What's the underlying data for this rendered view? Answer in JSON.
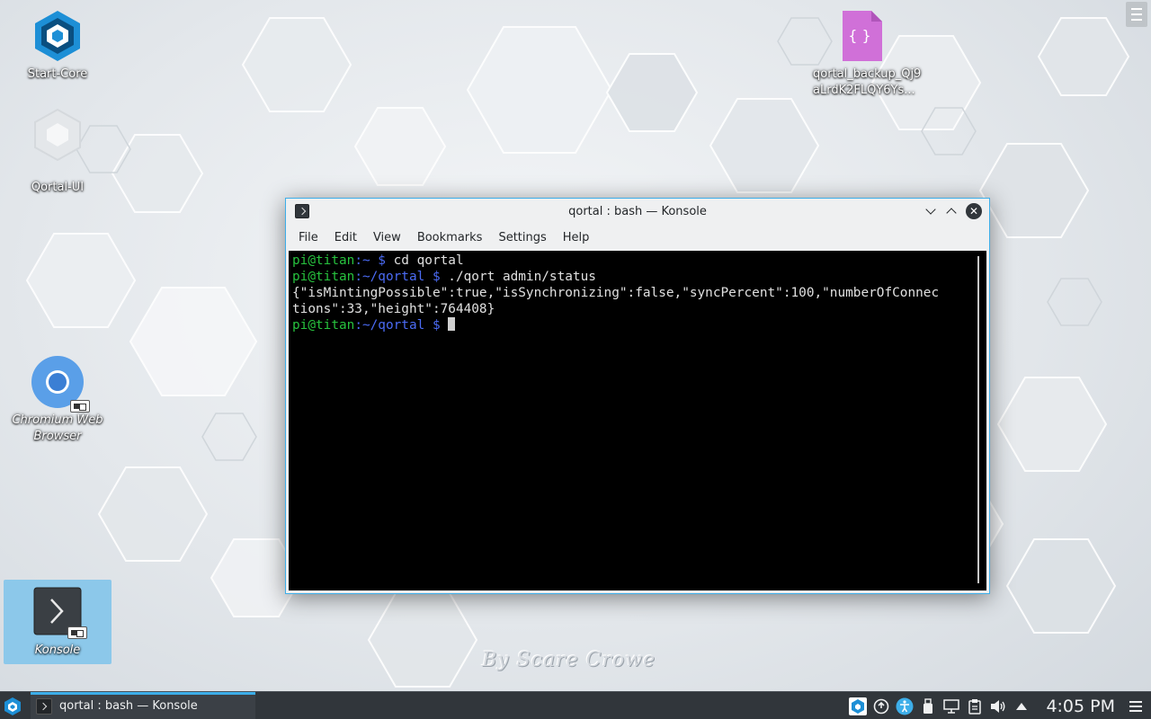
{
  "desktop": {
    "icons": [
      {
        "label": "Start-Core"
      },
      {
        "label": "Qortal-UI"
      },
      {
        "label_line1": "qortal_backup_Qj9",
        "label_line2": "aLrdK2FLQY6Ys..."
      },
      {
        "label_line1": "Chromium Web",
        "label_line2": "Browser"
      },
      {
        "label": "Konsole"
      }
    ],
    "file_icon_glyph": "{ }",
    "watermark": "By Scare Crowe"
  },
  "window": {
    "title": "qortal : bash — Konsole",
    "menu": [
      "File",
      "Edit",
      "View",
      "Bookmarks",
      "Settings",
      "Help"
    ]
  },
  "terminal": {
    "lines": [
      {
        "user": "pi@titan",
        "path": ":~",
        "prompt": " $ ",
        "cmd": "cd qortal"
      },
      {
        "user": "pi@titan",
        "path": ":~/qortal",
        "prompt": " $ ",
        "cmd": "./qort admin/status"
      },
      {
        "output": "{\"isMintingPossible\":true,\"isSynchronizing\":false,\"syncPercent\":100,\"numberOfConnec"
      },
      {
        "output": "tions\":33,\"height\":764408}"
      },
      {
        "user": "pi@titan",
        "path": ":~/qortal",
        "prompt": " $ ",
        "cmd": ""
      }
    ]
  },
  "taskbar": {
    "task_label": "qortal : bash — Konsole",
    "clock": "4:05 PM"
  },
  "colors": {
    "accent": "#3daee9",
    "prompt_user": "#27c23e",
    "prompt_path": "#4b6bf5",
    "panel": "#31363b"
  }
}
